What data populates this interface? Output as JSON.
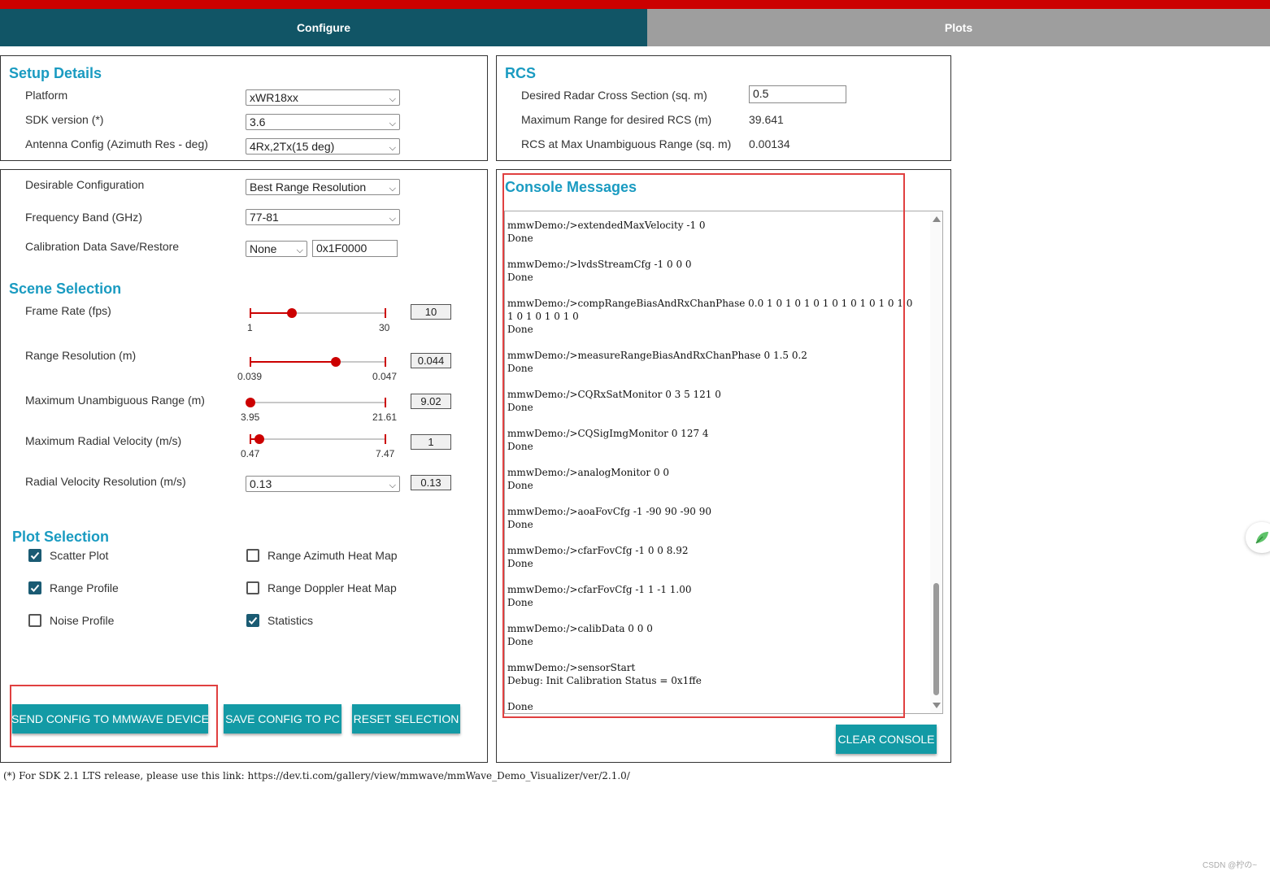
{
  "tabs": {
    "configure": "Configure",
    "plots": "Plots"
  },
  "setup": {
    "title": "Setup Details",
    "platform": {
      "label": "Platform",
      "value": "xWR18xx"
    },
    "sdk": {
      "label": "SDK version (*)",
      "value": "3.6"
    },
    "antenna": {
      "label": "Antenna Config (Azimuth Res - deg)",
      "value": "4Rx,2Tx(15 deg)"
    }
  },
  "rcs": {
    "title": "RCS",
    "desired": {
      "label": "Desired Radar Cross Section (sq. m)",
      "value": "0.5"
    },
    "maxrange": {
      "label": "Maximum Range for desired RCS (m)",
      "value": "39.641"
    },
    "atmax": {
      "label": "RCS at Max Unambiguous Range (sq. m)",
      "value": "0.00134"
    }
  },
  "config": {
    "desirable": {
      "label": "Desirable Configuration",
      "value": "Best Range Resolution"
    },
    "freq": {
      "label": "Frequency Band (GHz)",
      "value": "77-81"
    },
    "calib": {
      "label": "Calibration Data Save/Restore",
      "mode": "None",
      "address": "0x1F0000"
    }
  },
  "scene": {
    "title": "Scene Selection",
    "frame_rate": {
      "label": "Frame Rate (fps)",
      "min": "1",
      "max": "30",
      "value": "10",
      "fraction": 0.31
    },
    "range_res": {
      "label": "Range Resolution (m)",
      "min": "0.039",
      "max": "0.047",
      "value": "0.044",
      "fraction": 0.63
    },
    "max_range": {
      "label": "Maximum Unambiguous Range (m)",
      "min": "3.95",
      "max": "21.61",
      "value": "9.02",
      "fraction": 0.0
    },
    "max_vel": {
      "label": "Maximum Radial Velocity (m/s)",
      "min": "0.47",
      "max": "7.47",
      "value": "1",
      "fraction": 0.07
    },
    "vel_res": {
      "label": "Radial Velocity Resolution (m/s)",
      "select": "0.13",
      "value": "0.13"
    }
  },
  "plots": {
    "title": "Plot Selection",
    "scatter": {
      "label": "Scatter Plot",
      "checked": true
    },
    "range_profile": {
      "label": "Range Profile",
      "checked": true
    },
    "noise_profile": {
      "label": "Noise Profile",
      "checked": false
    },
    "range_azimuth": {
      "label": "Range Azimuth Heat Map",
      "checked": false
    },
    "range_doppler": {
      "label": "Range Doppler Heat Map",
      "checked": false
    },
    "statistics": {
      "label": "Statistics",
      "checked": true
    }
  },
  "buttons": {
    "send": "SEND CONFIG TO MMWAVE DEVICE",
    "save": "SAVE CONFIG TO PC",
    "reset": "RESET SELECTION",
    "clear": "CLEAR CONSOLE"
  },
  "console": {
    "title": "Console Messages",
    "lines": [
      "mmwDemo:/>extendedMaxVelocity -1 0",
      "Done",
      "",
      "mmwDemo:/>lvdsStreamCfg -1 0 0 0",
      "Done",
      "",
      "mmwDemo:/>compRangeBiasAndRxChanPhase 0.0 1 0 1 0 1 0 1 0 1 0 1 0 1 0 1 0",
      "1 0 1 0 1 0 1 0",
      "Done",
      "",
      "mmwDemo:/>measureRangeBiasAndRxChanPhase 0 1.5 0.2",
      "Done",
      "",
      "mmwDemo:/>CQRxSatMonitor 0 3 5 121 0",
      "Done",
      "",
      "mmwDemo:/>CQSigImgMonitor 0 127 4",
      "Done",
      "",
      "mmwDemo:/>analogMonitor 0 0",
      "Done",
      "",
      "mmwDemo:/>aoaFovCfg -1 -90 90 -90 90",
      "Done",
      "",
      "mmwDemo:/>cfarFovCfg -1 0 0 8.92",
      "Done",
      "",
      "mmwDemo:/>cfarFovCfg -1 1 -1 1.00",
      "Done",
      "",
      "mmwDemo:/>calibData 0 0 0",
      "Done",
      "",
      "mmwDemo:/>sensorStart",
      "Debug: Init Calibration Status = 0x1ffe",
      "",
      "Done"
    ]
  },
  "footnote": "(*) For SDK 2.1 LTS release, please use this link: https://dev.ti.com/gallery/view/mmwave/mmWave_Demo_Visualizer/ver/2.1.0/",
  "watermark": "CSDN @柠の~",
  "colors": {
    "header": "#115566",
    "topbar": "#cc0000",
    "accent": "#1a9bc1",
    "button": "#139aa5",
    "slider": "#cc0000"
  }
}
